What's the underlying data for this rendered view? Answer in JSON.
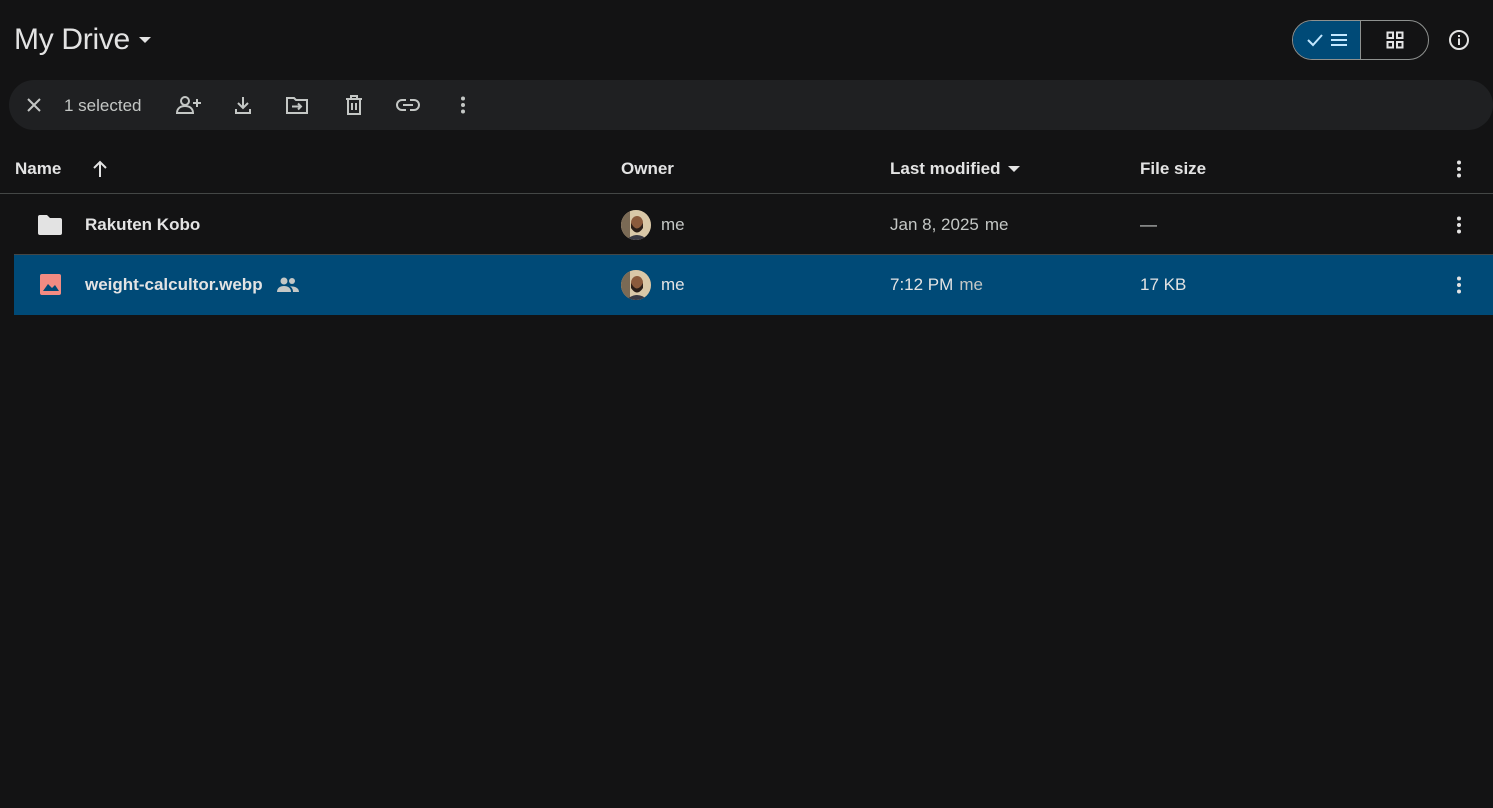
{
  "header": {
    "title": "My Drive",
    "title_dropdown_icon": "arrow-drop-down-icon",
    "view_toggle": {
      "list_view_icon": "list-view-icon",
      "list_check_icon": "check-icon",
      "grid_view_icon": "grid-view-icon",
      "active": "list"
    },
    "info_icon": "info-icon"
  },
  "selection_bar": {
    "count_label": "1 selected",
    "actions": [
      {
        "name": "clear-selection",
        "icon": "close-icon"
      },
      {
        "name": "share",
        "icon": "person-add-icon"
      },
      {
        "name": "download",
        "icon": "download-icon"
      },
      {
        "name": "move",
        "icon": "move-to-folder-icon"
      },
      {
        "name": "trash",
        "icon": "trash-icon"
      },
      {
        "name": "copy-link",
        "icon": "link-icon"
      },
      {
        "name": "more-actions",
        "icon": "more-vert-icon"
      }
    ]
  },
  "table": {
    "columns": {
      "name": "Name",
      "owner": "Owner",
      "last_modified": "Last modified",
      "file_size": "File size"
    },
    "sort": {
      "column": "name",
      "direction": "ascending",
      "icon": "arrow-up-icon"
    },
    "rows": [
      {
        "name": "Rakuten Kobo",
        "type_icon": "folder-icon",
        "shared": false,
        "owner": "me",
        "modified_date": "Jan 8, 2025",
        "modified_by": "me",
        "size": "—",
        "selected": false
      },
      {
        "name": "weight-calcultor.webp",
        "type_icon": "image-icon",
        "shared": true,
        "owner": "me",
        "modified_date": "7:12 PM",
        "modified_by": "me",
        "size": "17 KB",
        "selected": true
      }
    ]
  },
  "colors": {
    "background": "#131314",
    "selection_bar": "#1f2022",
    "selected_row": "#004a77",
    "image_icon": "#f28b82",
    "folder_icon": "#e3e3e3"
  }
}
